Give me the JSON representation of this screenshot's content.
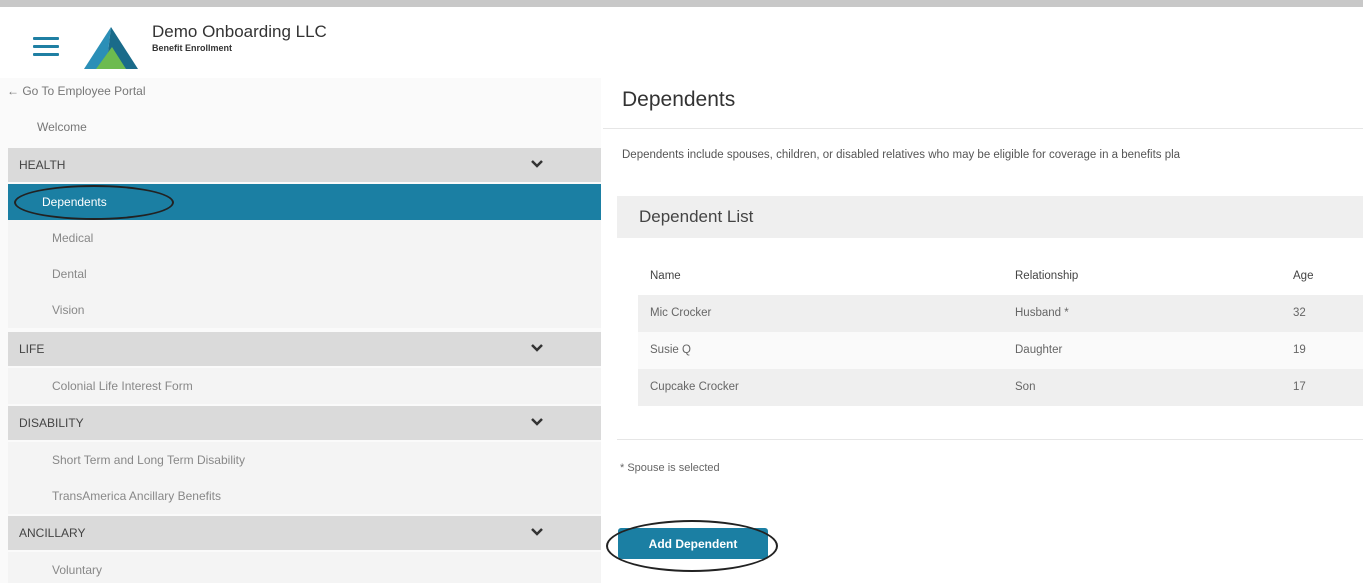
{
  "header": {
    "company": "Demo Onboarding LLC",
    "subtitle": "Benefit Enrollment",
    "menu_icon": "hamburger-icon",
    "logo_icon": "company-logo"
  },
  "sidebar": {
    "back_link": "← Go To Employee Portal",
    "welcome": "Welcome",
    "sections": [
      {
        "label": "HEALTH",
        "items": [
          "Dependents",
          "Medical",
          "Dental",
          "Vision"
        ]
      },
      {
        "label": "LIFE",
        "items": [
          "Colonial Life Interest Form"
        ]
      },
      {
        "label": "DISABILITY",
        "items": [
          "Short Term and Long Term Disability",
          "TransAmerica Ancillary Benefits"
        ]
      },
      {
        "label": "ANCILLARY",
        "items": [
          "Voluntary"
        ]
      }
    ],
    "active_item": "Dependents"
  },
  "main": {
    "title": "Dependents",
    "intro": "Dependents include spouses, children, or disabled relatives who may be eligible for coverage in a benefits pla",
    "list_title": "Dependent List",
    "columns": [
      "Name",
      "Relationship",
      "Age"
    ],
    "rows": [
      {
        "name": "Mic Crocker",
        "relationship": "Husband *",
        "age": "32"
      },
      {
        "name": "Susie Q",
        "relationship": "Daughter",
        "age": "19"
      },
      {
        "name": "Cupcake Crocker",
        "relationship": "Son",
        "age": "17"
      }
    ],
    "footnote": "* Spouse is selected",
    "add_button": "Add Dependent"
  },
  "colors": {
    "accent": "#1b7fa3",
    "section_bg": "#dadada",
    "annotation": "#222222"
  }
}
